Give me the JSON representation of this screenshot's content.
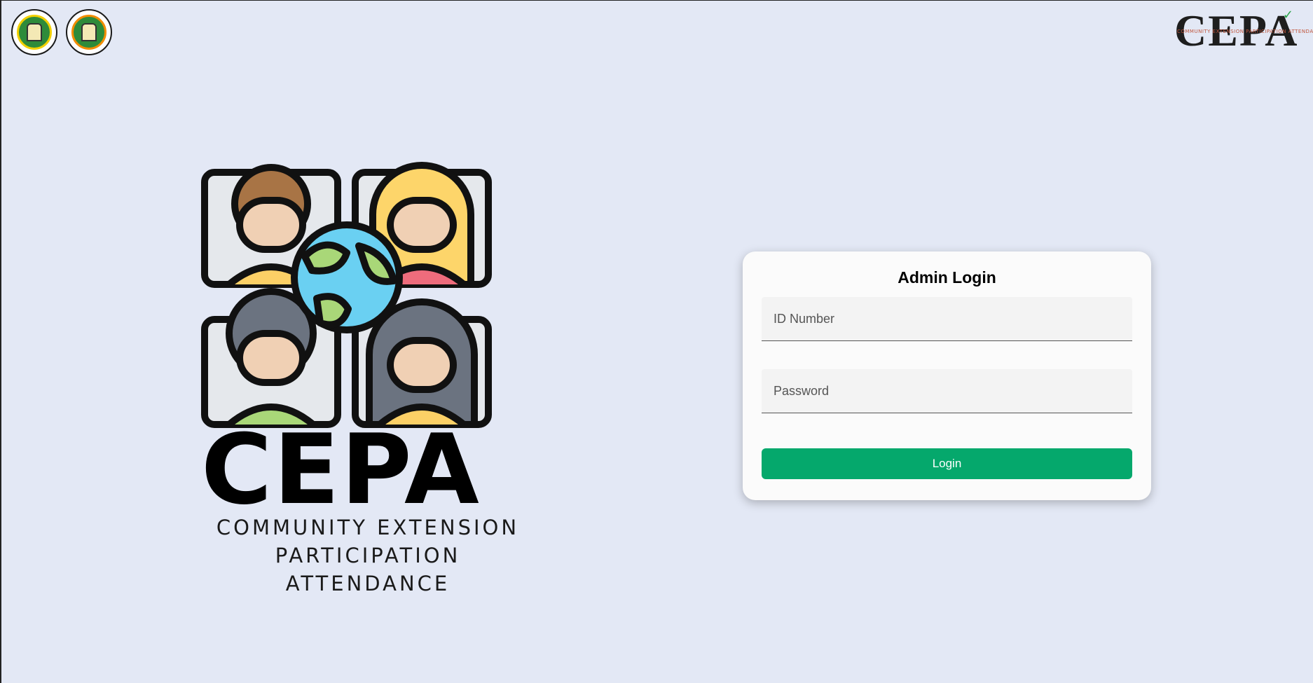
{
  "header": {
    "seals": [
      {
        "name": "gordon-college-seal"
      },
      {
        "name": "gordon-college-ccs-seal"
      }
    ],
    "brand": {
      "word": "CEPA",
      "tagline": "COMMUNITY EXTENSION PARTICIPATION ATTENDANCE"
    }
  },
  "hero": {
    "title": "CEPA",
    "subtitle_line1": "COMMUNITY EXTENSION",
    "subtitle_line2": "PARTICIPATION ATTENDANCE",
    "icon": "people-globe-illustration"
  },
  "login": {
    "title": "Admin Login",
    "id_placeholder": "ID Number",
    "password_placeholder": "Password",
    "button_label": "Login"
  },
  "colors": {
    "background": "#e3e8f5",
    "button": "#05a86c",
    "card": "#fbfbfb"
  }
}
